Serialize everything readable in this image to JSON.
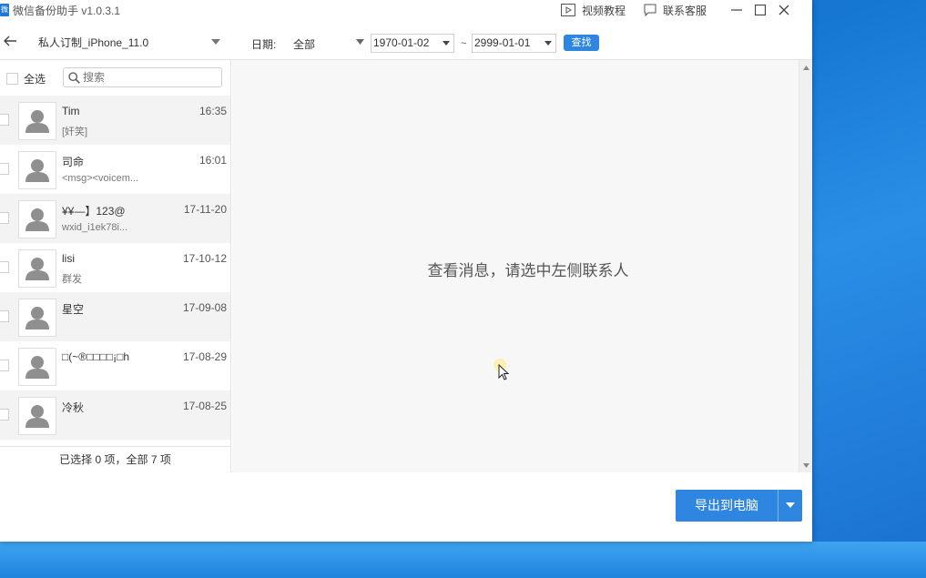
{
  "window": {
    "title": "微信备份助手 v1.0.3.1",
    "video_tutorial": "视频教程",
    "contact_support": "联系客服"
  },
  "toolbar": {
    "account": "私人订制_iPhone_11.0",
    "date_label": "日期:",
    "range": "全部",
    "start_date": "1970-01-02",
    "tilde": "~",
    "end_date": "2999-01-01",
    "search_label": "查找"
  },
  "left": {
    "select_all": "全选",
    "search_placeholder": "搜索",
    "contacts": [
      {
        "name": "Tim",
        "snippet": "[奸笑]",
        "time": "16:35"
      },
      {
        "name": "司命",
        "snippet": "<msg><voicem...",
        "time": "16:01"
      },
      {
        "name": "¥¥—】123@",
        "snippet": "wxid_i1ek78i...",
        "time": "17-11-20"
      },
      {
        "name": "lisi",
        "snippet": "群发",
        "time": "17-10-12"
      },
      {
        "name": "星空",
        "snippet": "",
        "time": "17-09-08"
      },
      {
        "name": "□(~®□□□□¡□h",
        "snippet": "",
        "time": "17-08-29"
      },
      {
        "name": "冷秋",
        "snippet": "",
        "time": "17-08-25"
      }
    ],
    "footer": "已选择 0 项，全部 7 项"
  },
  "right": {
    "placeholder": "查看消息，请选中左侧联系人"
  },
  "bottom": {
    "export_label": "导出到电脑"
  },
  "colors": {
    "accent": "#2f86e0",
    "desktop": "#1677d2"
  }
}
